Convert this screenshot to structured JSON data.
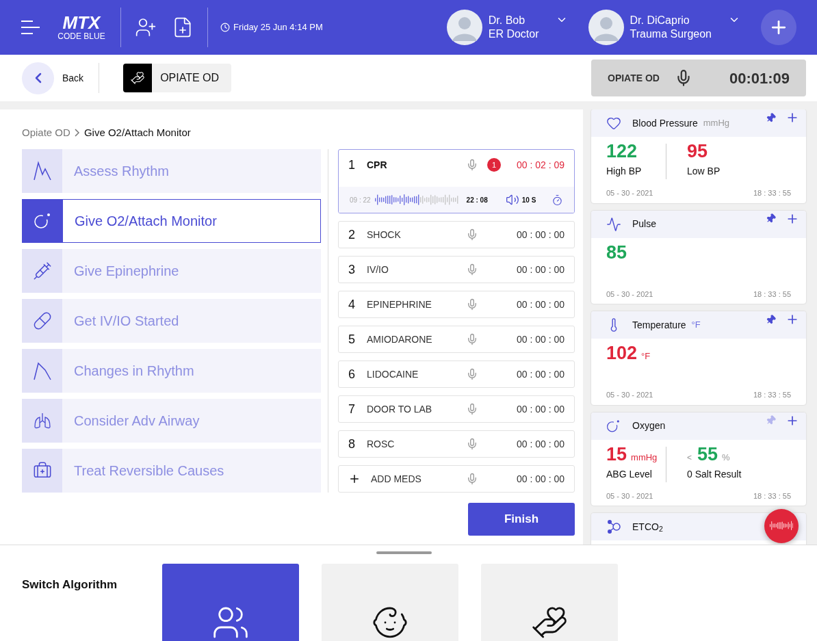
{
  "header": {
    "logo": "MTX",
    "logo_subtitle": "CODE BLUE",
    "datetime": "Friday 25 Jun 4:14 PM",
    "doctors": [
      {
        "name": "Dr. Bob",
        "role": "ER Doctor"
      },
      {
        "name": "Dr. DiCaprio",
        "role": "Trauma Surgeon"
      }
    ]
  },
  "subheader": {
    "back": "Back",
    "case": "OPIATE OD",
    "recorder": {
      "label": "OPIATE OD",
      "time": "00:01:09"
    }
  },
  "breadcrumb": [
    "Opiate OD",
    "Give O2/Attach Monitor"
  ],
  "algorithm_steps": [
    {
      "kind": "rhythm",
      "label": "Assess Rhythm",
      "selected": false
    },
    {
      "kind": "oxygen",
      "label": "Give O2/Attach Monitor",
      "selected": true
    },
    {
      "kind": "syringe",
      "label": "Give Epinephrine",
      "selected": false
    },
    {
      "kind": "pill",
      "label": "Get IV/IO Started",
      "selected": false
    },
    {
      "kind": "rhythm2",
      "label": "Changes in Rhythm",
      "selected": false
    },
    {
      "kind": "lungs",
      "label": "Consider Adv Airway",
      "selected": false
    },
    {
      "kind": "firstaid",
      "label": "Treat Reversible Causes",
      "selected": false
    }
  ],
  "actions": [
    {
      "kind": "step",
      "number": "1",
      "name": "CPR",
      "badge": "1",
      "time": "00 : 02 : 09",
      "running": true,
      "expanded": true,
      "selected": true,
      "recording": {
        "start": "09 : 22",
        "end": "22 : 08",
        "volume": "10 S"
      }
    },
    {
      "kind": "step",
      "number": "2",
      "name": "SHOCK",
      "time": "00 : 00 : 00",
      "running": false,
      "expanded": false,
      "selected": false
    },
    {
      "kind": "step",
      "number": "3",
      "name": "IV/IO",
      "time": "00 : 00 : 00",
      "running": false,
      "expanded": false,
      "selected": false
    },
    {
      "kind": "step",
      "number": "4",
      "name": "EPINEPHRINE",
      "time": "00 : 00 : 00",
      "running": false,
      "expanded": false,
      "selected": false
    },
    {
      "kind": "step",
      "number": "5",
      "name": "AMIODARONE",
      "time": "00 : 00 : 00",
      "running": false,
      "expanded": false,
      "selected": false
    },
    {
      "kind": "step",
      "number": "6",
      "name": "LIDOCAINE",
      "time": "00 : 00 : 00",
      "running": false,
      "expanded": false,
      "selected": false
    },
    {
      "kind": "step",
      "number": "7",
      "name": "DOOR TO LAB",
      "time": "00 : 00 : 00",
      "running": false,
      "expanded": false,
      "selected": false
    },
    {
      "kind": "step",
      "number": "8",
      "name": "ROSC",
      "time": "00 : 00 : 00",
      "running": false,
      "expanded": false,
      "selected": false
    },
    {
      "kind": "add",
      "name": "ADD MEDS",
      "time": "00 : 00 : 00",
      "running": false,
      "expanded": false,
      "selected": false
    }
  ],
  "finish": "Finish",
  "vitals": [
    {
      "kind": "heart",
      "title": "Blood Pressure",
      "unit": "mmHg",
      "pinned": true,
      "readings": [
        {
          "value": "122",
          "label": "High BP",
          "color": "#1fa75a"
        },
        {
          "value": "95",
          "label": "Low BP",
          "color": "#e0263b"
        }
      ],
      "date": "05 - 30 - 2021",
      "time": "18 : 33 : 55"
    },
    {
      "kind": "pulse",
      "title": "Pulse",
      "pinned": true,
      "readings": [
        {
          "value": "85",
          "color": "#1fa75a"
        }
      ],
      "date": "05 - 30 - 2021",
      "time": "18 : 33 : 55"
    },
    {
      "kind": "thermometer",
      "title": "Temperature",
      "unit": "°F",
      "pinned": true,
      "readings": [
        {
          "value": "102",
          "unit": "°F",
          "color": "#e0263b"
        }
      ],
      "date": "05 - 30 - 2021",
      "time": "18 : 33 : 55"
    },
    {
      "kind": "oxygen",
      "title": "Oxygen",
      "pinned": false,
      "readings": [
        {
          "value": "15",
          "unit": "mmHg",
          "label": "ABG Level",
          "color": "#e0263b"
        },
        {
          "prefix": "<",
          "value": "55",
          "unit": "%",
          "label": "0 Salt Result",
          "color": "#1fa75a"
        }
      ],
      "date": "05 - 30 - 2021",
      "time": "18 : 33 : 55"
    },
    {
      "kind": "molecule",
      "title": "ETCO$_{2}$"
    }
  ],
  "switch": {
    "title": "Switch Algorithm",
    "algorithms": [
      {
        "kind": "adults",
        "selected": true
      },
      {
        "kind": "children",
        "selected": false
      },
      {
        "kind": "cpr",
        "selected": false
      }
    ]
  }
}
